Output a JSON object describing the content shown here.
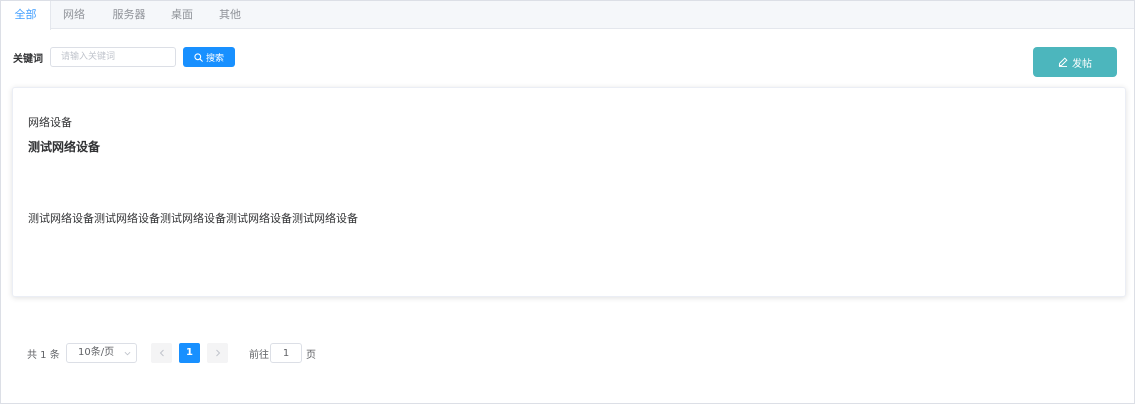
{
  "tabs": [
    {
      "label": "全部",
      "active": true
    },
    {
      "label": "网络",
      "active": false
    },
    {
      "label": "服务器",
      "active": false
    },
    {
      "label": "桌面",
      "active": false
    },
    {
      "label": "其他",
      "active": false
    }
  ],
  "search": {
    "label": "关键词",
    "placeholder": "请输入关键词",
    "value": "",
    "button_label": "搜索"
  },
  "post_button_label": "发帖",
  "post": {
    "category": "网络设备",
    "title": "测试网络设备",
    "body": "测试网络设备测试网络设备测试网络设备测试网络设备测试网络设备"
  },
  "pagination": {
    "total_text": "共 1 条",
    "page_size": "10条/页",
    "current_page": "1",
    "goto_label": "前往",
    "goto_value": "1",
    "goto_suffix": "页"
  },
  "colors": {
    "primary": "#1890ff",
    "post_button": "#4cb6bd",
    "active_tab_text": "#409eff"
  },
  "icons": {
    "search_button": "search-icon",
    "post_button": "edit-icon",
    "page_size": "chevron-down-icon",
    "prev": "chevron-left-icon",
    "next": "chevron-right-icon"
  }
}
